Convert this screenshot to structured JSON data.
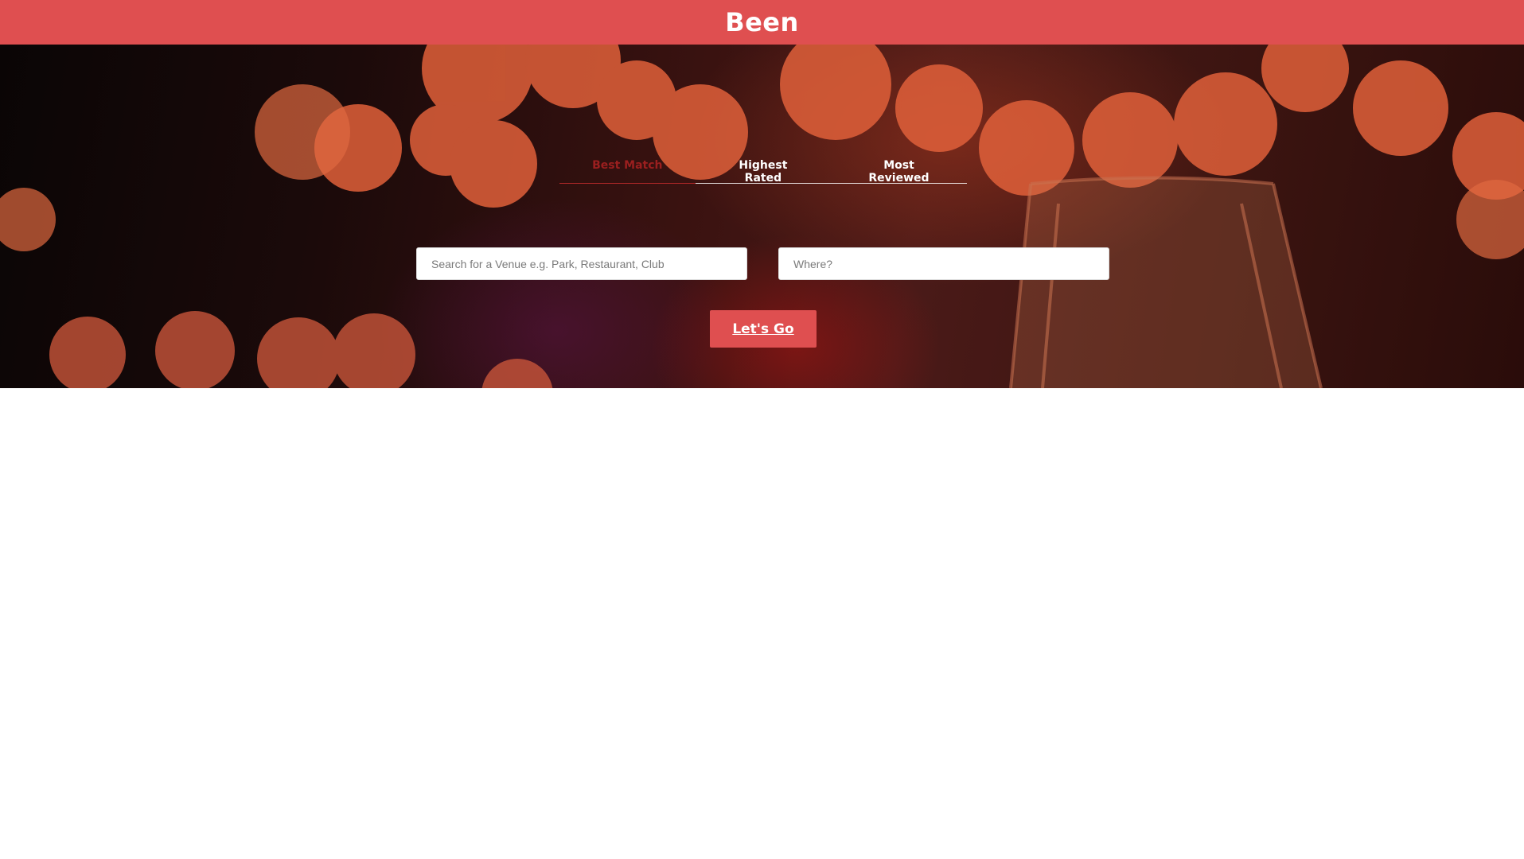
{
  "header": {
    "brand": "Been"
  },
  "tabs": [
    {
      "label": "Best Match",
      "active": true
    },
    {
      "label": "Highest Rated",
      "active": false
    },
    {
      "label": "Most Reviewed",
      "active": false
    }
  ],
  "search": {
    "venue_placeholder": "Search for a Venue e.g. Park, Restaurant, Club",
    "venue_value": "",
    "where_placeholder": "Where?",
    "where_value": ""
  },
  "actions": {
    "go_label": "Let's Go"
  },
  "colors": {
    "brand": "#df4f50",
    "active_tab": "#9b1f1f"
  }
}
